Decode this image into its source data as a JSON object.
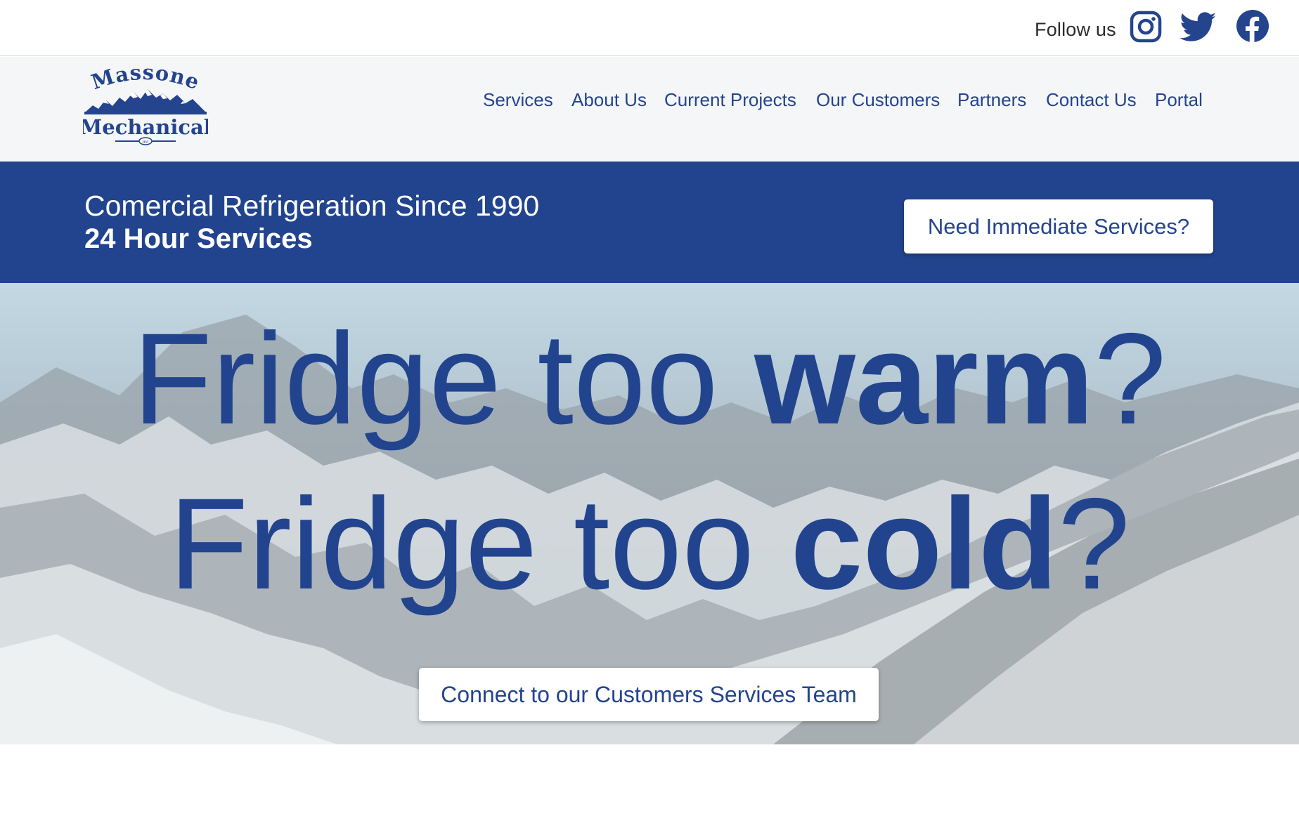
{
  "top_bar": {
    "follow_label": "Follow us",
    "social_icons": [
      "instagram-icon",
      "twitter-icon",
      "facebook-icon"
    ]
  },
  "logo": {
    "line1": "Massone",
    "line2": "Mechanical",
    "suffix": "Inc"
  },
  "nav": {
    "items": [
      "Services",
      "About Us",
      "Current Projects",
      "Our Customers",
      "Partners",
      "Contact Us",
      "Portal"
    ]
  },
  "band": {
    "line1": "Comercial Refrigeration Since 1990",
    "line2": "24 Hour Services",
    "button_label": "Need Immediate Services?"
  },
  "hero": {
    "line1_prefix": "Fridge too ",
    "line1_emphasis": "warm",
    "line1_suffix": "?",
    "line2_prefix": "Fridge too ",
    "line2_emphasis": "cold",
    "line2_suffix": "?",
    "button_label": "Connect to our Customers Services Team"
  },
  "colors": {
    "brand_blue": "#22448e",
    "nav_background": "#f5f6f8",
    "button_background": "#ffffff"
  }
}
